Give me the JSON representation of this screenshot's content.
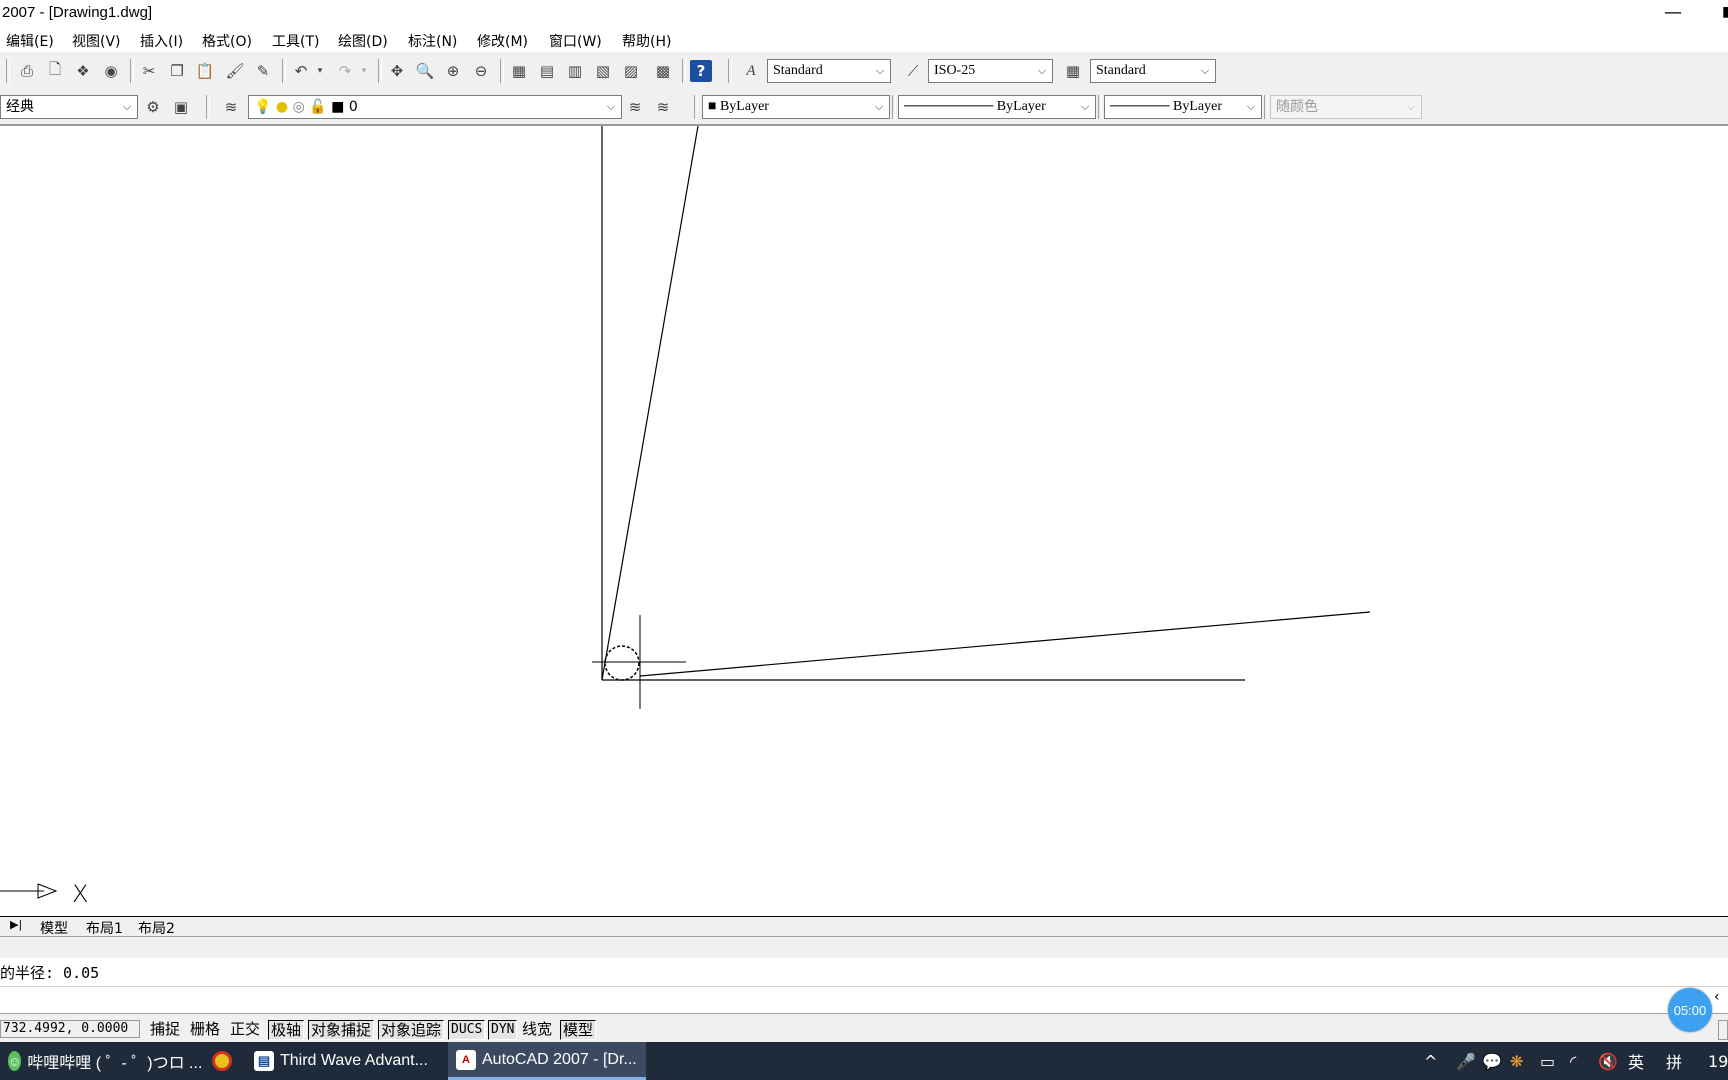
{
  "window": {
    "title": "2007 - [Drawing1.dwg]",
    "minimize_glyph": "—",
    "right_edge_glyph": "▮"
  },
  "menu": [
    "编辑(E)",
    "视图(V)",
    "插入(I)",
    "格式(O)",
    "工具(T)",
    "绘图(D)",
    "标注(N)",
    "修改(M)",
    "窗口(W)",
    "帮助(H)"
  ],
  "toolbar": {
    "text_style": "Standard",
    "dim_style": "ISO-25",
    "table_style": "Standard",
    "workspace": "经典",
    "layer": "0",
    "color": "ByLayer",
    "linetype": "ByLayer",
    "lineweight": "ByLayer",
    "plot_style": "随颜色"
  },
  "tabs": {
    "nav_glyph": "▶|",
    "items": [
      "模型",
      "布局1",
      "布局2"
    ]
  },
  "command": {
    "line1": "的半径: 0.05",
    "line2": ""
  },
  "status": {
    "coords": "732.4992, 0.0000",
    "buttons": [
      {
        "label": "捕捉",
        "pressed": false
      },
      {
        "label": "栅格",
        "pressed": false
      },
      {
        "label": "正交",
        "pressed": false
      },
      {
        "label": "极轴",
        "pressed": true
      },
      {
        "label": "对象捕捉",
        "pressed": true
      },
      {
        "label": "对象追踪",
        "pressed": true
      },
      {
        "label": "DUCS",
        "pressed": true
      },
      {
        "label": "DYN",
        "pressed": true
      },
      {
        "label": "线宽",
        "pressed": false
      },
      {
        "label": "模型",
        "pressed": true
      }
    ]
  },
  "timer": "05:00",
  "taskbar": {
    "items": [
      {
        "label": "哔哩哔哩 ( ゜- ゜)つロ ...",
        "active": false
      },
      {
        "label": "",
        "active": false
      },
      {
        "label": "Third Wave Advant...",
        "active": false
      },
      {
        "label": "AutoCAD 2007 - [Dr...",
        "active": true
      }
    ],
    "lang": "英",
    "clock": "19"
  },
  "colors": {
    "taskbar_bg": "#1f2a3a",
    "toolbar_bg": "#f0f0f0",
    "timer_bg": "#3da0f0"
  }
}
